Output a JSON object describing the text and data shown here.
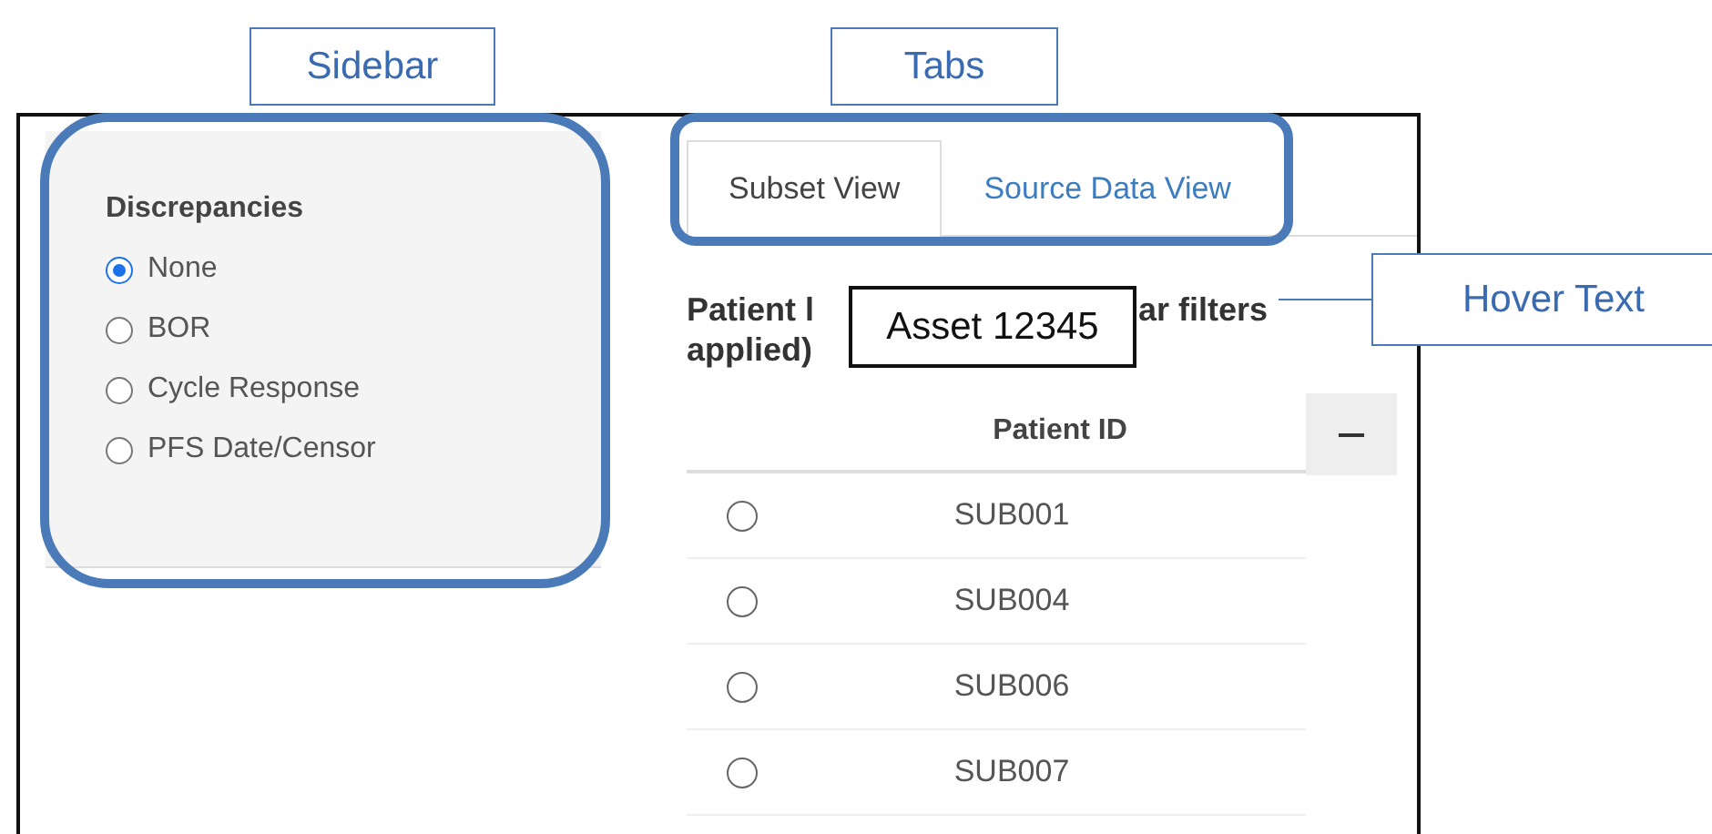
{
  "callouts": [
    {
      "label": "Sidebar"
    },
    {
      "label": "Tabs"
    },
    {
      "label": "Hover Text"
    }
  ],
  "sidebar": {
    "title": "Discrepancies",
    "options": [
      {
        "label": "None",
        "selected": true
      },
      {
        "label": "BOR",
        "selected": false
      },
      {
        "label": "Cycle Response",
        "selected": false
      },
      {
        "label": "PFS Date/Censor",
        "selected": false
      }
    ]
  },
  "tabs": [
    {
      "label": "Subset View",
      "selected": true
    },
    {
      "label": "Source Data View",
      "selected": false
    }
  ],
  "heading": {
    "visible_start": "Patient l",
    "visible_end": "ar filters",
    "line_2": "applied)"
  },
  "tooltip": "Asset 12345",
  "table": {
    "columns": [
      "Patient ID"
    ],
    "rows": [
      {
        "id": "SUB001",
        "selected": false
      },
      {
        "id": "SUB004",
        "selected": false
      },
      {
        "id": "SUB006",
        "selected": false
      },
      {
        "id": "SUB007",
        "selected": false
      }
    ]
  }
}
